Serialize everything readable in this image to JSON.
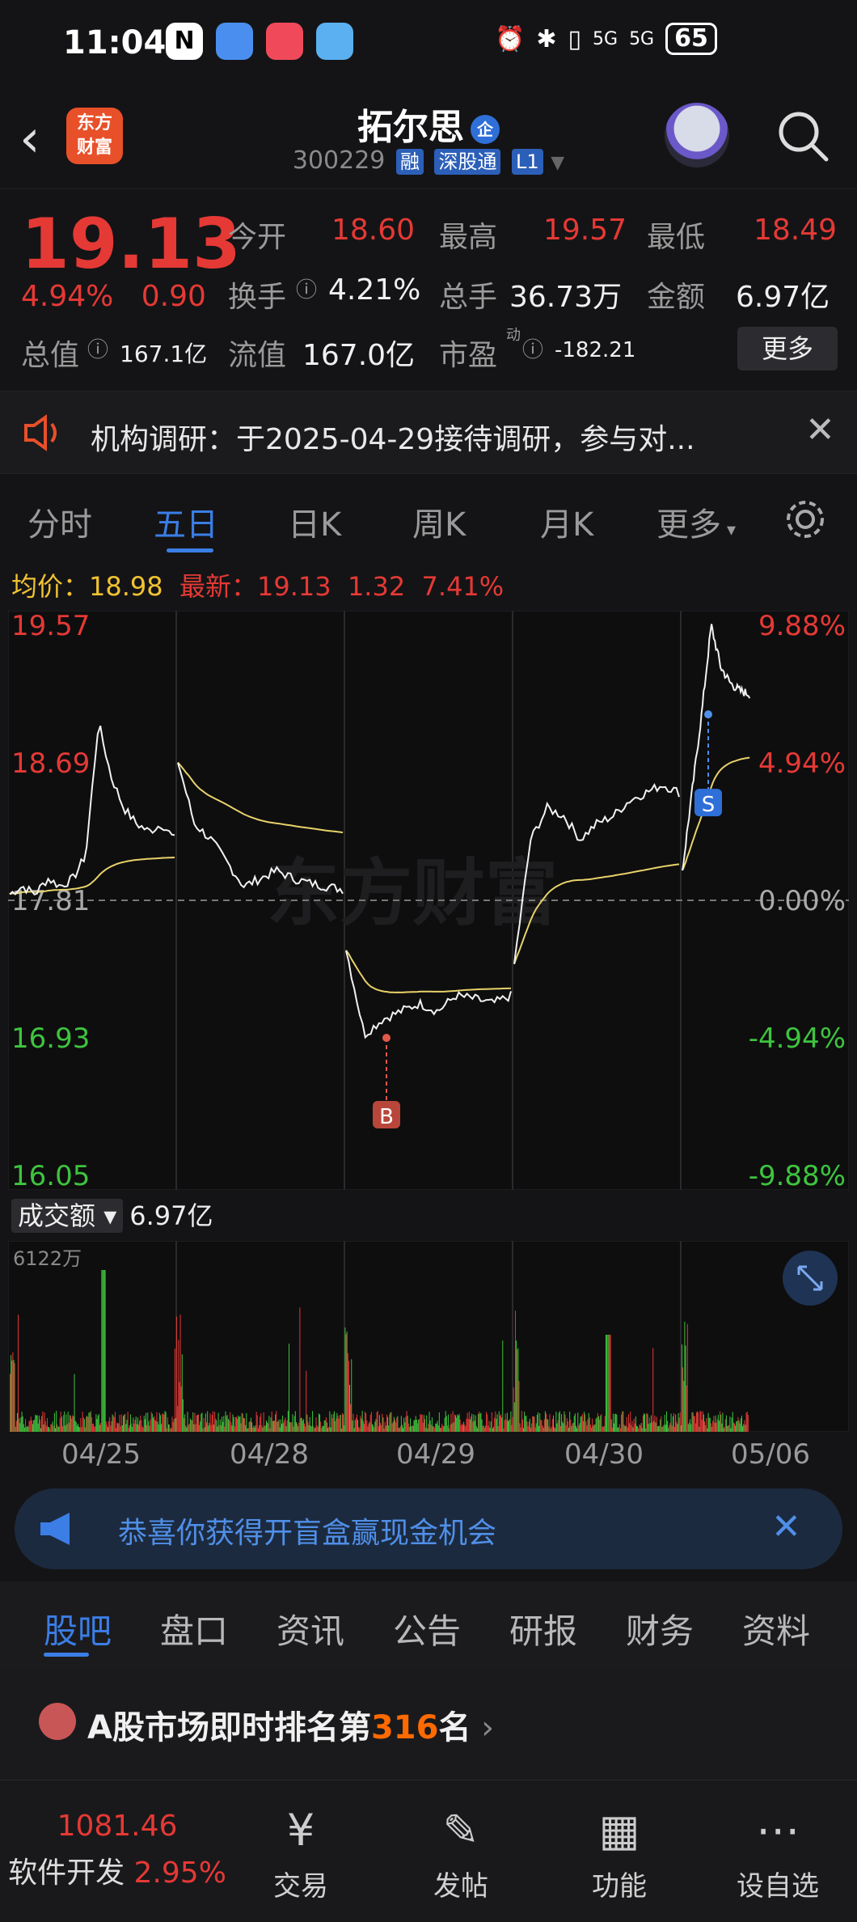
{
  "status": {
    "time": "11:04",
    "battery": "65",
    "signal1": "5G",
    "signal2": "5G"
  },
  "header": {
    "logo_line1": "东方",
    "logo_line2": "财富",
    "title": "拓尔思",
    "badge": "企",
    "code": "300229",
    "tags": [
      "融",
      "深股通",
      "L1"
    ]
  },
  "quote": {
    "price": "19.13",
    "pct": "4.94%",
    "change": "0.90",
    "open_label": "今开",
    "open": "18.60",
    "high_label": "最高",
    "high": "19.57",
    "low_label": "最低",
    "low": "18.49",
    "turnover_label": "换手",
    "turnover": "4.21%",
    "volume_label": "总手",
    "volume": "36.73万",
    "amount_label": "金额",
    "amount": "6.97亿",
    "mktcap_label": "总值",
    "mktcap": "167.1亿",
    "float_label": "流值",
    "float": "167.0亿",
    "pe_label": "市盈",
    "pe_sup": "动",
    "pe": "-182.21",
    "more": "更多"
  },
  "notice": {
    "text": "机构调研：于2025-04-29接待调研，参与对..."
  },
  "tabs": [
    "分时",
    "五日",
    "日K",
    "周K",
    "月K",
    "更多"
  ],
  "avg": {
    "avg_label": "均价：",
    "avg": "18.98",
    "latest_label": "最新：",
    "latest": "19.13",
    "chg": "1.32",
    "pct": "7.41%"
  },
  "chart_data": {
    "type": "line",
    "title": "",
    "x": [
      "04/25",
      "04/28",
      "04/29",
      "04/30",
      "05/06"
    ],
    "y_left": [
      "19.57",
      "18.69",
      "17.81",
      "16.93",
      "16.05"
    ],
    "y_right": [
      "9.88%",
      "4.94%",
      "0.00%",
      "-4.94%",
      "-9.88%"
    ],
    "ylim": [
      16.05,
      19.57
    ],
    "prev_close": 17.81,
    "series": [
      {
        "values": [
          17.85,
          18.95,
          18.3,
          17.9,
          17.92,
          16.95,
          17.15,
          17.18,
          17.2,
          18.2,
          18.35,
          18.4,
          18.75,
          19.0,
          19.57,
          19.2
        ]
      }
    ],
    "markers": [
      {
        "label": "B",
        "value": 16.93
      },
      {
        "label": "S",
        "value": 19.0
      }
    ],
    "watermark": "东方财富",
    "volume": {
      "label": "成交额",
      "value": "6.97亿",
      "max_label": "6122万"
    }
  },
  "banner": {
    "text": "恭喜你获得开盲盒赢现金机会"
  },
  "subtabs": [
    "股吧",
    "盘口",
    "资讯",
    "公告",
    "研报",
    "财务",
    "资料"
  ],
  "rank": {
    "prefix": "A股市场即时排名第",
    "num": "316",
    "suffix": "名"
  },
  "bottom": {
    "index_value": "1081.46",
    "index_name": "软件开发",
    "index_pct": "2.95%",
    "items": [
      "交易",
      "发帖",
      "功能",
      "设自选"
    ]
  }
}
